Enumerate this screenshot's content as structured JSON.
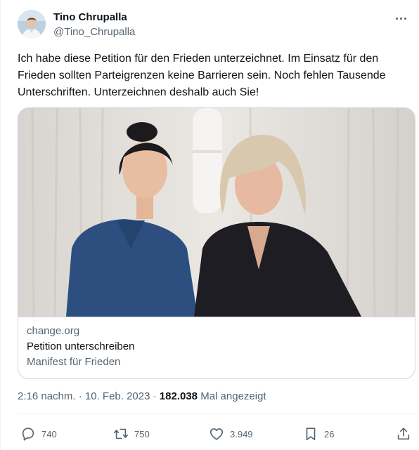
{
  "author": {
    "display_name": "Tino Chrupalla",
    "handle": "@Tino_Chrupalla",
    "avatar_icon": "user-avatar"
  },
  "tweet": {
    "text": "Ich habe diese Petition für den Frieden unterzeichnet. Im Einsatz für den Frieden sollten Parteigrenzen keine Barrieren sein. Noch fehlen Tausende Unterschriften. Unterzeichnen deshalb auch Sie!"
  },
  "card": {
    "domain": "change.org",
    "title": "Petition unterschreiben",
    "description": "Manifest für Frieden"
  },
  "meta": {
    "timestamp": "2:16 nachm. · 10. Feb. 2023 · ",
    "views_count": "182.038",
    "views_label": " Mal angezeigt"
  },
  "actions": {
    "replies": "740",
    "retweets": "750",
    "likes": "3.949",
    "bookmarks": "26"
  },
  "icons": {
    "more": "more-icon",
    "reply": "reply-icon",
    "retweet": "retweet-icon",
    "like": "like-icon",
    "bookmark": "bookmark-icon",
    "share": "share-icon"
  },
  "colors": {
    "text": "#0f1419",
    "secondary": "#536471",
    "border": "#cfd9de"
  }
}
